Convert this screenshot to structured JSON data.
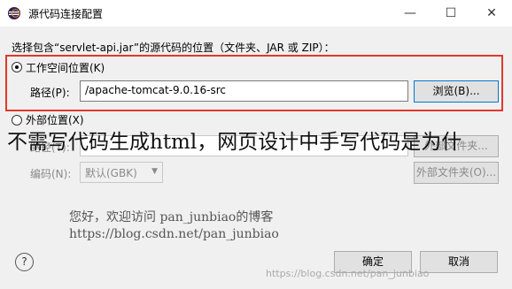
{
  "window": {
    "title": "源代码连接配置",
    "minimize": "—",
    "maximize": "☐",
    "close": "✕"
  },
  "prompt": "选择包含“servlet-api.jar”的源代码的位置（文件夹、JAR 或 ZIP）：",
  "workspace": {
    "radio_label": "工作空间位置(K)",
    "selected": true,
    "path_label": "路径(P):",
    "path_value": "/apache-tomcat-9.0.16-src",
    "browse_label": "浏览(B)..."
  },
  "external": {
    "radio_label": "外部位置(X)",
    "selected": false,
    "path_label": "路径(T):",
    "path_value": "",
    "ext_folder_label": "外部文件夹...",
    "encoding_label": "编码(N):",
    "encoding_value": "默认(GBK)",
    "ext_folder2_label": "外部文件夹(O)..."
  },
  "overlay_text": "不需写代码生成html，网页设计中手写代码是为什",
  "watermark": {
    "line1": "您好，欢迎访问 pan_junbiao的博客",
    "line2": "https://blog.csdn.net/pan_junbiao",
    "corner": "https://blog.csdn.net/pan_junbiao"
  },
  "footer": {
    "help": "?",
    "ok_label": "确定",
    "cancel_label": "取消"
  },
  "colors": {
    "highlight": "#e0392b",
    "focus_border": "#0078d7"
  },
  "icons": {
    "app": "eclipse-icon",
    "help": "help-icon"
  }
}
